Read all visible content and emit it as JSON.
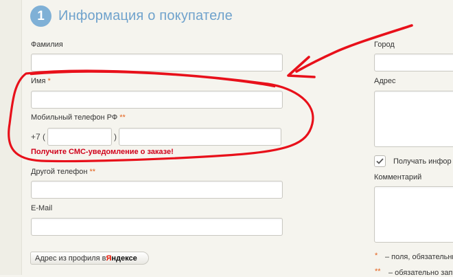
{
  "header": {
    "step": "1",
    "title": "Информация о покупателе"
  },
  "left": {
    "last_name_label": "Фамилия",
    "first_name_label": "Имя",
    "first_name_req": "*",
    "mobile_label": "Мобильный телефон РФ",
    "mobile_req": "**",
    "phone_prefix": "+7 (",
    "phone_close": ")",
    "sms_notice": "Получите СМС-уведомление о заказе!",
    "other_phone_label": "Другой телефон",
    "other_phone_req": "**",
    "email_label": "E-Mail",
    "yandex_button": {
      "prefix": "Адрес из профиля в ",
      "brand_first": "Я",
      "brand_rest": "ндексе"
    }
  },
  "right": {
    "city_label": "Город",
    "address_label": "Адрес",
    "notify_checkbox_label": "Получать инфор",
    "comment_label": "Комментарий",
    "legend": [
      {
        "mark": "*",
        "text": "– поля, обязательные"
      },
      {
        "mark": "**",
        "text": "– обязательно зап"
      }
    ]
  },
  "colors": {
    "accent": "#7fb0d6",
    "required": "#e3601a",
    "warning": "#d0021b",
    "annotation": "#e8101a"
  }
}
